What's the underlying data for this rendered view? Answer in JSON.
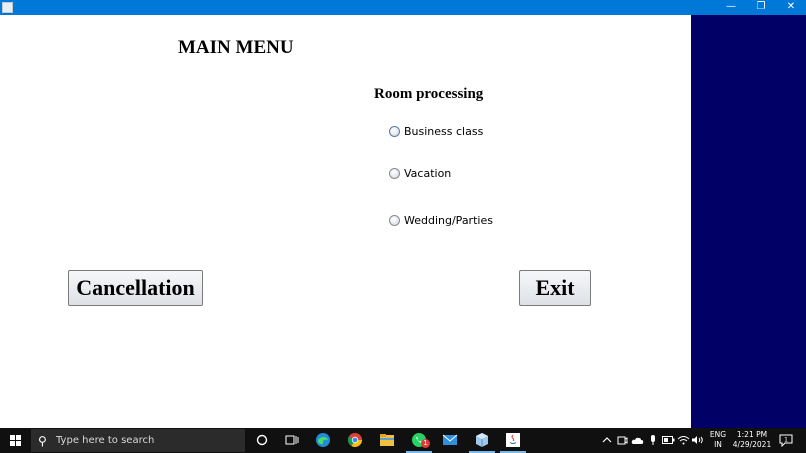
{
  "window": {
    "controls": {
      "minimize": "—",
      "maximize": "❐",
      "close": "✕"
    }
  },
  "main": {
    "title": "MAIN MENU",
    "section_heading": "Room processing",
    "options": [
      {
        "label": "Business class"
      },
      {
        "label": "Vacation"
      },
      {
        "label": "Wedding/Parties"
      }
    ],
    "buttons": {
      "cancellation": "Cancellation",
      "exit": "Exit"
    }
  },
  "taskbar": {
    "search_placeholder": "Type here to search",
    "whatsapp_badge": "1",
    "tray": {
      "language_top": "ENG",
      "language_bottom": "IN",
      "time": "1:21 PM",
      "date": "4/29/2021",
      "notification_count": "1"
    },
    "icons": [
      "cortana-icon",
      "task-view-icon",
      "edge-icon",
      "chrome-icon",
      "file-explorer-icon",
      "whatsapp-icon",
      "mail-icon",
      "app-cube-icon",
      "java-icon"
    ]
  },
  "colors": {
    "titlebar": "#0078d7",
    "side_panel": "#000066",
    "taskbar": "#101010"
  }
}
